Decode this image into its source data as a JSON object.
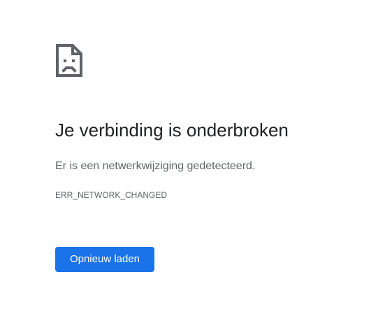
{
  "error_page": {
    "icon": "sad-page-icon",
    "title": "Je verbinding is onderbroken",
    "description": "Er is een netwerkwijziging gedetecteerd.",
    "error_code": "ERR_NETWORK_CHANGED",
    "reload_button_label": "Opnieuw laden"
  },
  "colors": {
    "background": "#ffffff",
    "title": "#202124",
    "secondary_text": "#5f6368",
    "button": "#1a73e8",
    "button_text": "#ffffff"
  }
}
